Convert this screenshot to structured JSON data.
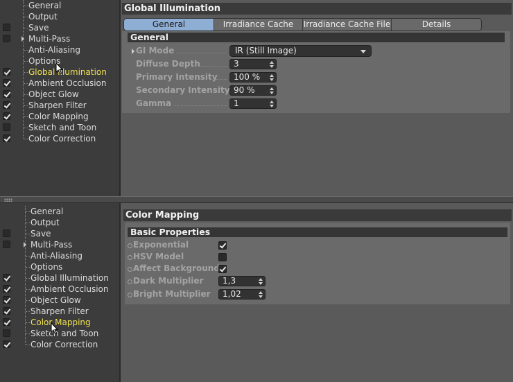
{
  "top": {
    "sidebar": {
      "items": [
        {
          "label": "General",
          "checkbox": "none"
        },
        {
          "label": "Output",
          "checkbox": "none"
        },
        {
          "label": "Save",
          "checkbox": "off"
        },
        {
          "label": "Multi-Pass",
          "checkbox": "off",
          "expandable": true
        },
        {
          "label": "Anti-Aliasing",
          "checkbox": "none"
        },
        {
          "label": "Options",
          "checkbox": "none"
        },
        {
          "label": "Global Illumination",
          "checkbox": "on",
          "active": true
        },
        {
          "label": "Ambient Occlusion",
          "checkbox": "on"
        },
        {
          "label": "Object Glow",
          "checkbox": "on"
        },
        {
          "label": "Sharpen Filter",
          "checkbox": "on"
        },
        {
          "label": "Color Mapping",
          "checkbox": "on"
        },
        {
          "label": "Sketch and Toon",
          "checkbox": "off"
        },
        {
          "label": "Color Correction",
          "checkbox": "on"
        }
      ]
    },
    "panel_title": "Global Illumination",
    "tabs": [
      {
        "label": "General",
        "selected": true
      },
      {
        "label": "Irradiance Cache"
      },
      {
        "label": "Irradiance Cache File"
      },
      {
        "label": "Details"
      }
    ],
    "section_title": "General",
    "gi_mode": {
      "label": "GI Mode",
      "value": "IR (Still Image)"
    },
    "diffuse_depth": {
      "label": "Diffuse Depth",
      "value": "3"
    },
    "primary_intensity": {
      "label": "Primary Intensity",
      "value": "100 %"
    },
    "secondary_intensity": {
      "label": "Secondary Intensity",
      "value": "90 %"
    },
    "gamma": {
      "label": "Gamma",
      "value": "1"
    }
  },
  "bottom": {
    "sidebar": {
      "items": [
        {
          "label": "General",
          "checkbox": "none"
        },
        {
          "label": "Output",
          "checkbox": "none"
        },
        {
          "label": "Save",
          "checkbox": "off"
        },
        {
          "label": "Multi-Pass",
          "checkbox": "off",
          "expandable": true
        },
        {
          "label": "Anti-Aliasing",
          "checkbox": "none"
        },
        {
          "label": "Options",
          "checkbox": "none"
        },
        {
          "label": "Global Illumination",
          "checkbox": "on"
        },
        {
          "label": "Ambient Occlusion",
          "checkbox": "on"
        },
        {
          "label": "Object Glow",
          "checkbox": "on"
        },
        {
          "label": "Sharpen Filter",
          "checkbox": "on"
        },
        {
          "label": "Color Mapping",
          "checkbox": "on",
          "active": true
        },
        {
          "label": "Sketch and Toon",
          "checkbox": "off"
        },
        {
          "label": "Color Correction",
          "checkbox": "on"
        }
      ]
    },
    "panel_title": "Color Mapping",
    "section_title": "Basic Properties",
    "exponential": {
      "label": "Exponential",
      "checked": true
    },
    "hsv_model": {
      "label": "HSV Model",
      "checked": false
    },
    "affect_background": {
      "label": "Affect Background",
      "checked": true
    },
    "dark_multiplier": {
      "label": "Dark Multiplier",
      "value": "1,3"
    },
    "bright_multiplier": {
      "label": "Bright Multiplier",
      "value": "1,02"
    }
  },
  "colors": {
    "active_item": "#f0e050",
    "selected_tab": "#8faed3",
    "title_bar": "#3a3a3a"
  },
  "icons": [
    "checkbox-icon",
    "expand-arrow-icon",
    "dropdown-caret-icon",
    "spinner-arrows-icon",
    "mouse-cursor-icon",
    "splitter-grip-icon"
  ]
}
